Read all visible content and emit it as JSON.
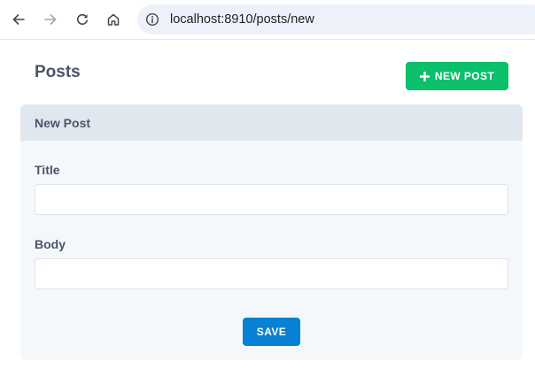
{
  "browser": {
    "url": "localhost:8910/posts/new",
    "icons": {
      "back": "arrow-left-icon",
      "forward": "arrow-right-icon",
      "reload": "reload-icon",
      "home": "home-icon",
      "site_info": "info-icon"
    }
  },
  "page": {
    "title": "Posts",
    "new_post_button": "NEW POST",
    "new_post_icon": "plus-icon"
  },
  "form": {
    "header": "New Post",
    "fields": [
      {
        "label": "Title",
        "value": "",
        "placeholder": ""
      },
      {
        "label": "Body",
        "value": "",
        "placeholder": ""
      }
    ],
    "save_button": "SAVE"
  },
  "colors": {
    "accent_green": "#0bbf6b",
    "save_blue": "#0880d3",
    "card_background": "#f5f8fb",
    "card_header_background": "#e1e7ef",
    "omnibox_background": "#edf2fa"
  }
}
